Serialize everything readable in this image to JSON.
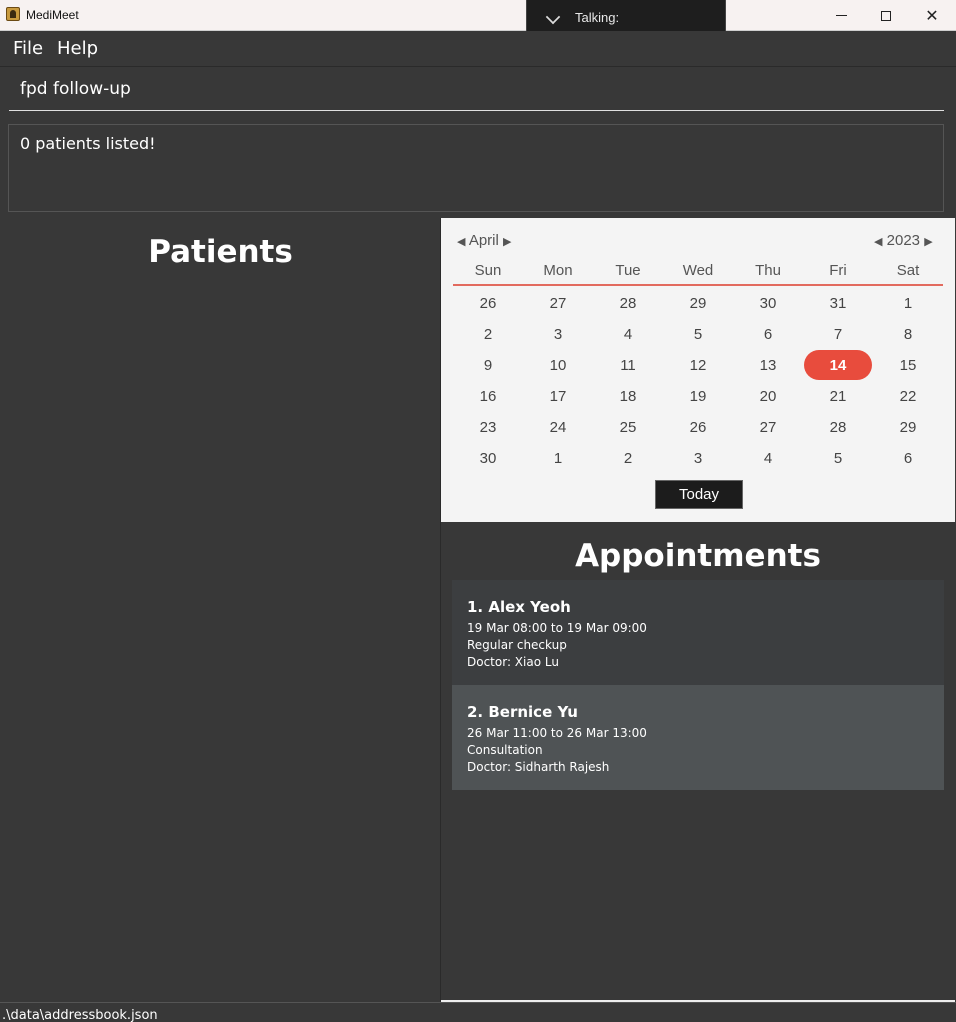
{
  "window": {
    "title": "MediMeet"
  },
  "talking_popup": {
    "label": "Talking:"
  },
  "menu": {
    "file": "File",
    "help": "Help"
  },
  "command": {
    "value": "fpd follow-up"
  },
  "result": {
    "message": "0 patients listed!"
  },
  "patients": {
    "title": "Patients"
  },
  "calendar": {
    "month": "April",
    "year": "2023",
    "weekdays": [
      "Sun",
      "Mon",
      "Tue",
      "Wed",
      "Thu",
      "Fri",
      "Sat"
    ],
    "weeks": [
      [
        "26",
        "27",
        "28",
        "29",
        "30",
        "31",
        "1"
      ],
      [
        "2",
        "3",
        "4",
        "5",
        "6",
        "7",
        "8"
      ],
      [
        "9",
        "10",
        "11",
        "12",
        "13",
        "14",
        "15"
      ],
      [
        "16",
        "17",
        "18",
        "19",
        "20",
        "21",
        "22"
      ],
      [
        "23",
        "24",
        "25",
        "26",
        "27",
        "28",
        "29"
      ],
      [
        "30",
        "1",
        "2",
        "3",
        "4",
        "5",
        "6"
      ]
    ],
    "selected_day": "14",
    "today_label": "Today",
    "accent_color": "#e84c3d"
  },
  "appointments": {
    "title": "Appointments",
    "items": [
      {
        "header": "1.  Alex Yeoh",
        "time": "19 Mar 08:00 to 19 Mar 09:00",
        "description": "Regular checkup",
        "doctor": "Doctor: Xiao Lu"
      },
      {
        "header": "2.  Bernice Yu",
        "time": "26 Mar 11:00 to 26 Mar 13:00",
        "description": "Consultation",
        "doctor": "Doctor: Sidharth Rajesh"
      }
    ]
  },
  "status": {
    "path": ".\\data\\addressbook.json"
  }
}
